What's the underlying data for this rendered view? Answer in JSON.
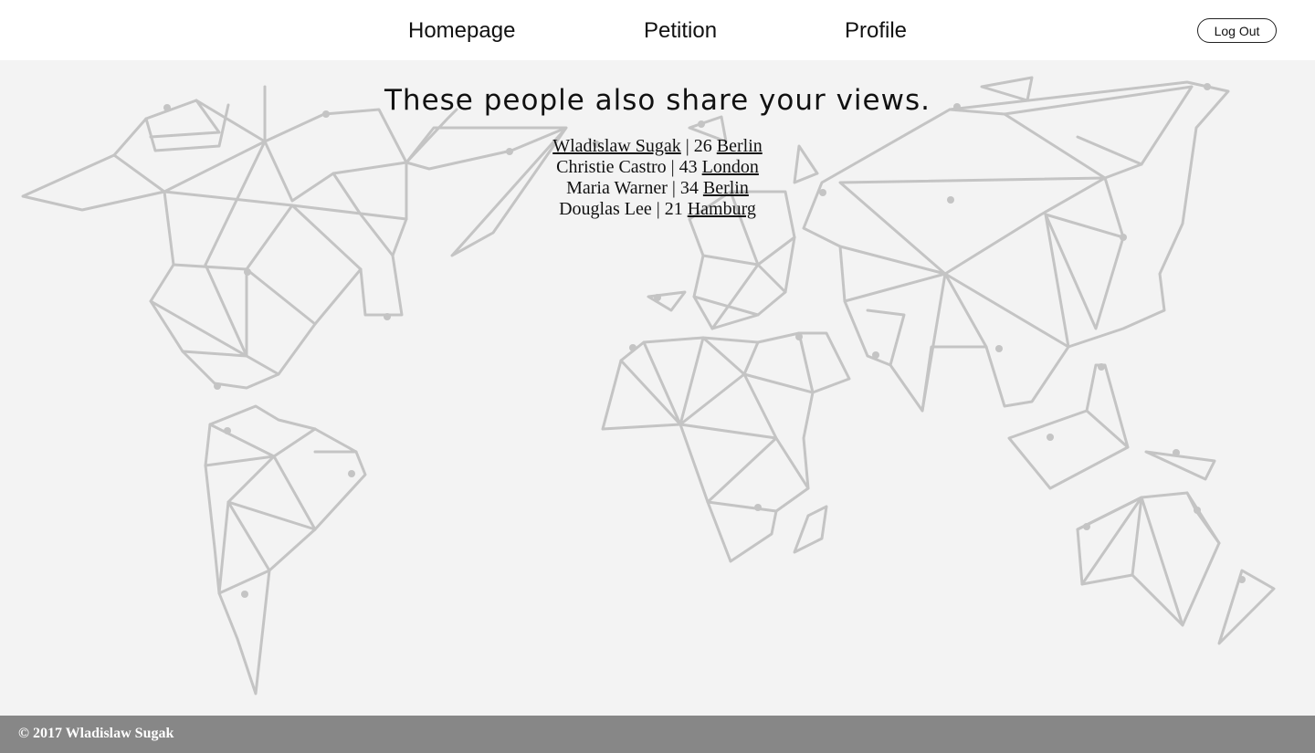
{
  "nav": {
    "homepage": "Homepage",
    "petition": "Petition",
    "profile": "Profile",
    "logout": "Log Out"
  },
  "main": {
    "heading": "These people also share your views.",
    "signers": [
      {
        "name": "Wladislaw Sugak",
        "name_is_link": true,
        "age": "26",
        "city": "Berlin"
      },
      {
        "name": "Christie Castro",
        "name_is_link": false,
        "age": "43",
        "city": "London"
      },
      {
        "name": "Maria Warner",
        "name_is_link": false,
        "age": "34",
        "city": "Berlin"
      },
      {
        "name": "Douglas Lee",
        "name_is_link": false,
        "age": "21",
        "city": "Hamburg"
      }
    ]
  },
  "footer": {
    "copyright": "© 2017 Wladislaw Sugak"
  },
  "colors": {
    "nav_bg": "#ffffff",
    "page_bg": "#f3f3f3",
    "map_lines": "#c4c4c4",
    "footer_bg": "#878787"
  }
}
